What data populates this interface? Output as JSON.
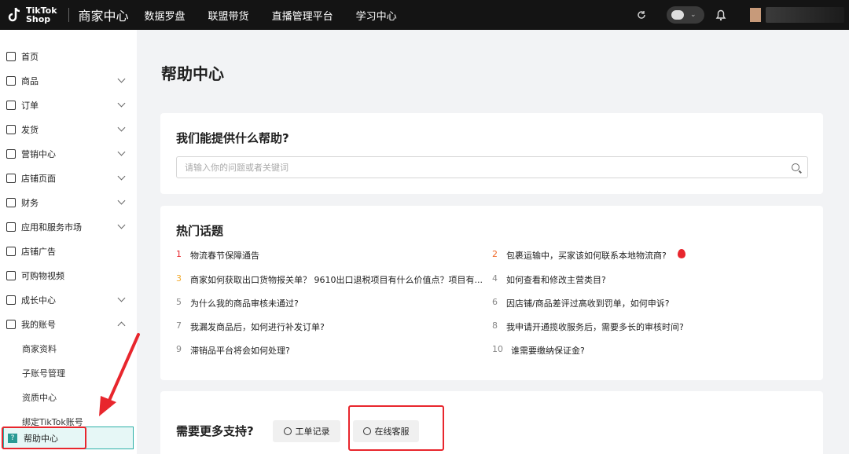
{
  "header": {
    "logo_text_1": "TikTok",
    "logo_text_2": "Shop",
    "brand": "商家中心",
    "nav": [
      "数据罗盘",
      "联盟带货",
      "直播管理平台",
      "学习中心"
    ]
  },
  "sidebar": {
    "items": [
      {
        "label": "首页",
        "icon": "home-icon",
        "chevron": false
      },
      {
        "label": "商品",
        "icon": "product-icon",
        "chevron": true
      },
      {
        "label": "订单",
        "icon": "order-icon",
        "chevron": true
      },
      {
        "label": "发货",
        "icon": "truck-icon",
        "chevron": true
      },
      {
        "label": "营销中心",
        "icon": "megaphone-icon",
        "chevron": true
      },
      {
        "label": "店铺页面",
        "icon": "store-icon",
        "chevron": true
      },
      {
        "label": "财务",
        "icon": "wallet-icon",
        "chevron": true
      },
      {
        "label": "应用和服务市场",
        "icon": "apps-icon",
        "chevron": true
      },
      {
        "label": "店铺广告",
        "icon": "ad-icon",
        "chevron": false
      },
      {
        "label": "可购物视频",
        "icon": "video-icon",
        "chevron": false
      },
      {
        "label": "成长中心",
        "icon": "medal-icon",
        "chevron": true
      },
      {
        "label": "我的账号",
        "icon": "user-icon",
        "chevron": true
      }
    ],
    "sub_items": [
      "商家资料",
      "子账号管理",
      "资质中心",
      "绑定TikTok账号"
    ],
    "help": "帮助中心"
  },
  "main": {
    "title": "帮助中心",
    "help_card": {
      "title": "我们能提供什么帮助?",
      "search_placeholder": "请输入你的问题或者关键词"
    },
    "hot": {
      "title": "热门话题",
      "topics": [
        {
          "num": "1",
          "text": "物流春节保障通告"
        },
        {
          "num": "2",
          "text": "包裹运输中，买家该如何联系本地物流商?"
        },
        {
          "num": "3",
          "text": "商家如何获取出口货物报关单？ 9610出口退税项目有什么价值点？项目有..."
        },
        {
          "num": "4",
          "text": "如何查看和修改主营类目?"
        },
        {
          "num": "5",
          "text": "为什么我的商品审核未通过?"
        },
        {
          "num": "6",
          "text": "因店铺/商品差评过高收到罚单，如何申诉?"
        },
        {
          "num": "7",
          "text": "我漏发商品后，如何进行补发订单?"
        },
        {
          "num": "8",
          "text": "我申请开通揽收服务后，需要多长的审核时间?"
        },
        {
          "num": "9",
          "text": "滞销品平台将会如何处理?"
        },
        {
          "num": "10",
          "text": "谁需要缴纳保证金?"
        }
      ]
    },
    "support": {
      "title": "需要更多支持?",
      "ticket_button": "工单记录",
      "chat_button": "在线客服"
    }
  },
  "colors": {
    "accent": "#2bb0a8",
    "highlight": "#e8262d",
    "topbar": "#141414"
  }
}
